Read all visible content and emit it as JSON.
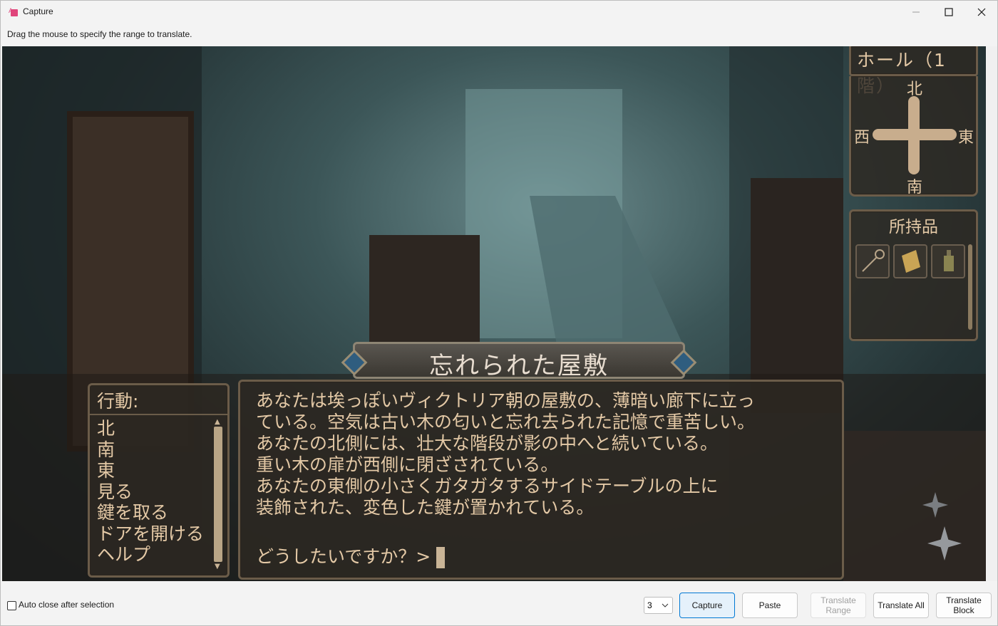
{
  "window": {
    "title": "Capture",
    "instruction": "Drag the mouse to specify the range to translate."
  },
  "game": {
    "location": "ホール（1階）",
    "compass": {
      "north": "北",
      "west": "西",
      "east": "東",
      "south": "南"
    },
    "inventory_title": "所持品",
    "inventory_items": [
      "key-icon",
      "scroll-icon",
      "bottle-icon"
    ],
    "scene_title": "忘れられた屋敷",
    "actions_title": "行動:",
    "actions": [
      "北",
      "南",
      "東",
      "見る",
      "鍵を取る",
      "ドアを開ける",
      "ヘルプ"
    ],
    "story": "あなたは埃っぽいヴィクトリア朝の屋敷の、薄暗い廊下に立っ\nている。空気は古い木の匂いと忘れ去られた記憶で重苦しい。\nあなたの北側には、壮大な階段が影の中へと続いている。\n重い木の扉が西側に閉ざされている。\nあなたの東側の小さくガタガタするサイドテーブルの上に\n装飾された、変色した鍵が置かれている。",
    "prompt": "どうしたいですか？>"
  },
  "controls": {
    "auto_close_label": "Auto close after selection",
    "select_value": "3",
    "capture": "Capture",
    "paste": "Paste",
    "translate_range": "Translate Range",
    "translate_all": "Translate All",
    "translate_block": "Translate Block"
  },
  "colors": {
    "accent": "#0078d4",
    "game_text": "#e4c9a6"
  }
}
